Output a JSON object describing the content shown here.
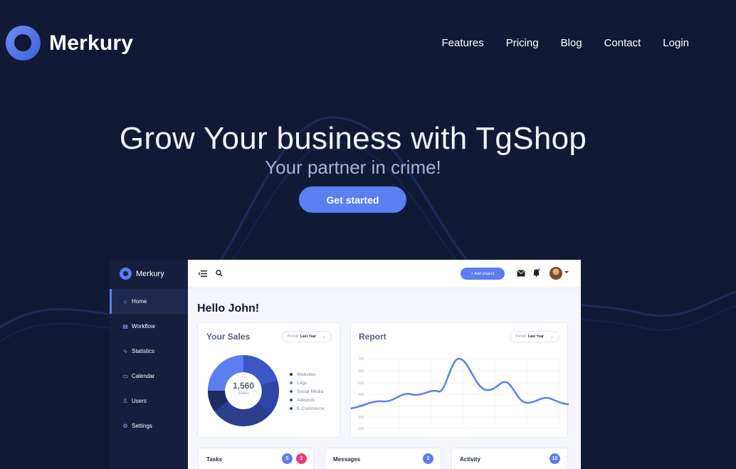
{
  "colors": {
    "background": "#111a35",
    "accent": "#5b7ff1",
    "pink": "#ef3b7d"
  },
  "brand": {
    "name": "Merkury"
  },
  "nav": {
    "items": [
      "Features",
      "Pricing",
      "Blog",
      "Contact",
      "Login"
    ]
  },
  "hero": {
    "title": "Grow Your business with TgShop",
    "subtitle": "Your partner in crime!",
    "cta_label": "Get started"
  },
  "dashboard": {
    "brand": "Merkury",
    "sidebar": [
      {
        "label": "Home",
        "icon": "home-icon",
        "active": true
      },
      {
        "label": "Workflow",
        "icon": "workflow-icon"
      },
      {
        "label": "Statistics",
        "icon": "statistics-icon"
      },
      {
        "label": "Calendar",
        "icon": "calendar-icon"
      },
      {
        "label": "Users",
        "icon": "users-icon"
      },
      {
        "label": "Settings",
        "icon": "settings-icon"
      }
    ],
    "topbar": {
      "add_project_label": "+ Add project"
    },
    "greeting": "Hello John!",
    "sales": {
      "title": "Your Sales",
      "period_label": "Period:",
      "period_value": "Last Year",
      "total": "1,560",
      "total_label": "Sales",
      "legend": [
        "Websites",
        "Logo",
        "Social Media",
        "Adwords",
        "E-Commerce"
      ]
    },
    "report": {
      "title": "Report",
      "period_label": "Period:",
      "period_value": "Last Year",
      "y_ticks": [
        "700",
        "600",
        "500",
        "400",
        "300",
        "200",
        "100"
      ]
    },
    "tasks": {
      "label": "Tasks",
      "badges": [
        "5",
        "2"
      ]
    },
    "messages": {
      "label": "Messages",
      "badges": [
        "2"
      ]
    },
    "activity": {
      "label": "Activity",
      "badges": [
        "10"
      ]
    }
  }
}
